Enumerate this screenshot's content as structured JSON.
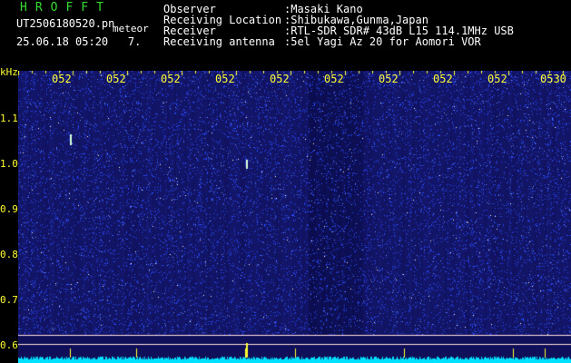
{
  "header": {
    "brand": "HROFFT",
    "file_name": "UT2506180520.pn",
    "mode": "meteor",
    "date_time": "25.06.18 05:20",
    "count": "7.",
    "info": [
      {
        "label": "Observer",
        "value": ":Masaki Kano"
      },
      {
        "label": "Receiving Location",
        "value": ":Shibukawa,Gunma,Japan"
      },
      {
        "label": "Receiver",
        "value": ":RTL-SDR SDR# 43dB L15 114.1MHz USB"
      },
      {
        "label": "Receiving antenna",
        "value": ":5el Yagi Az 20 for Aomori VOR"
      }
    ]
  },
  "spectrogram": {
    "unit": "kHz",
    "y_ticks": [
      "1.1",
      "1.0",
      "0.9",
      "0.8",
      "0.7",
      "0.6"
    ],
    "time_ticks": [
      "052",
      "052",
      "052",
      "052",
      "052",
      "052",
      "052",
      "052",
      "052",
      "0530"
    ],
    "colors": {
      "background": "#10105a",
      "noise": "#2a4cff",
      "trace": "#00e0ff",
      "tick": "#ffff33",
      "baseline": "#ffdddd"
    }
  }
}
